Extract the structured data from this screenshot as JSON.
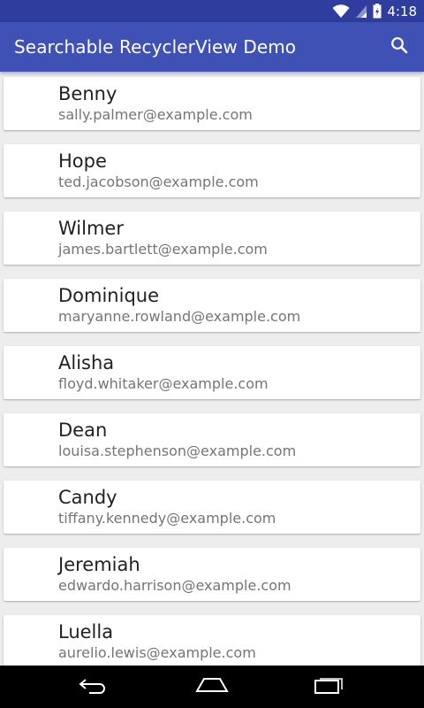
{
  "status_bar": {
    "time": "4:18"
  },
  "app_bar": {
    "title": "Searchable RecyclerView Demo"
  },
  "contacts": [
    {
      "name": "Benny",
      "email": "sally.palmer@example.com"
    },
    {
      "name": "Hope",
      "email": "ted.jacobson@example.com"
    },
    {
      "name": "Wilmer",
      "email": "james.bartlett@example.com"
    },
    {
      "name": "Dominique",
      "email": "maryanne.rowland@example.com"
    },
    {
      "name": "Alisha",
      "email": "floyd.whitaker@example.com"
    },
    {
      "name": "Dean",
      "email": "louisa.stephenson@example.com"
    },
    {
      "name": "Candy",
      "email": "tiffany.kennedy@example.com"
    },
    {
      "name": "Jeremiah",
      "email": "edwardo.harrison@example.com"
    },
    {
      "name": "Luella",
      "email": "aurelio.lewis@example.com"
    }
  ],
  "colors": {
    "app_bar": "#3f51b5",
    "status_bar": "#2e3d9e",
    "background": "#ededed"
  },
  "icons": {
    "search": "search-icon",
    "back": "back-icon",
    "home": "home-icon",
    "recents": "recents-icon"
  }
}
